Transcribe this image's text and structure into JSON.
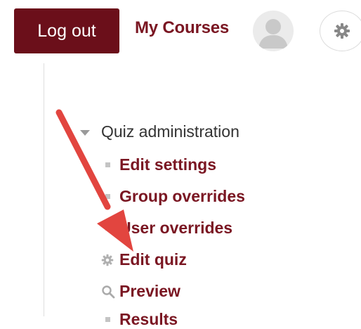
{
  "header": {
    "logout_label": "Log out",
    "my_courses_label": "My Courses"
  },
  "admin": {
    "title": "Quiz administration",
    "items": [
      {
        "label": "Edit settings",
        "icon": "bullet-icon"
      },
      {
        "label": "Group overrides",
        "icon": "bullet-icon"
      },
      {
        "label": "User overrides",
        "icon": "bullet-icon"
      },
      {
        "label": "Edit quiz",
        "icon": "gear-icon"
      },
      {
        "label": "Preview",
        "icon": "search-icon"
      },
      {
        "label": "Results",
        "icon": "bullet-icon"
      }
    ]
  },
  "colors": {
    "brand": "#6b0f1a",
    "link": "#7a1622",
    "arrow": "#e2453f"
  }
}
